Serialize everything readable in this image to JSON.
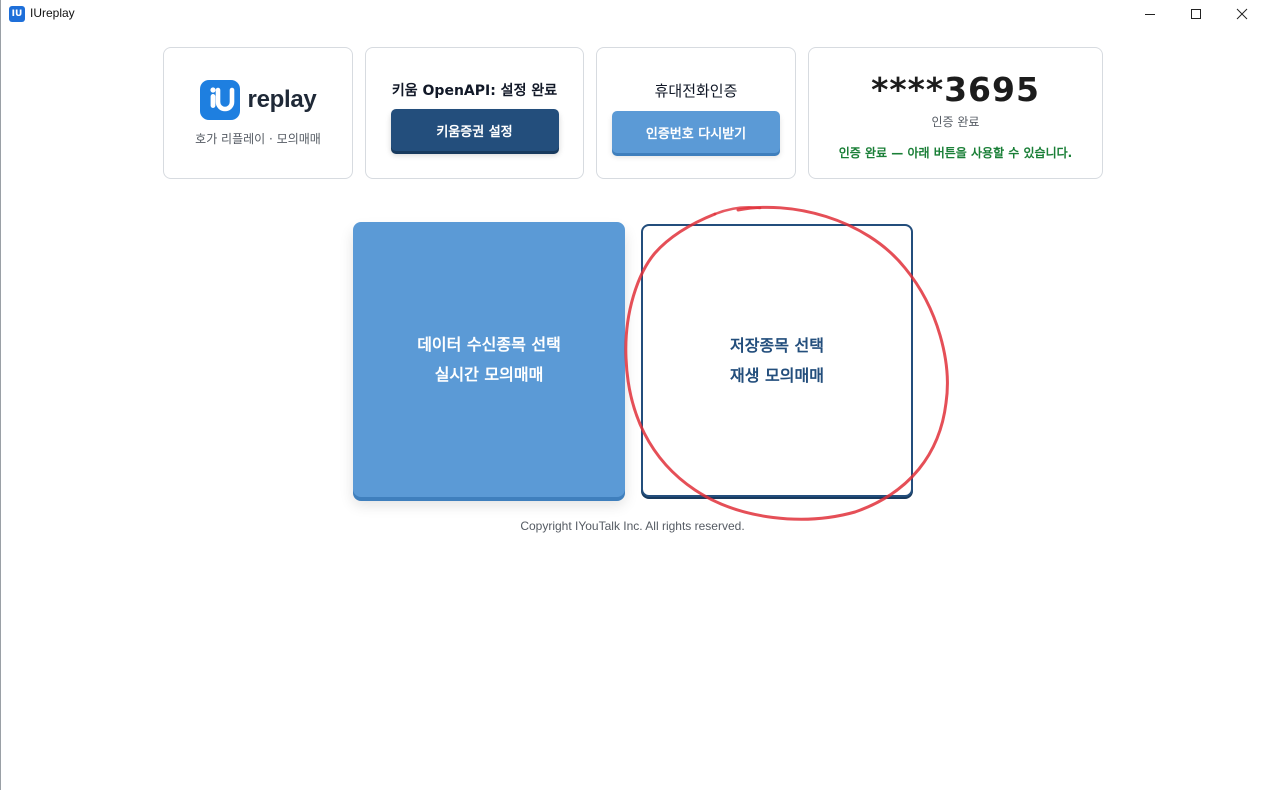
{
  "window": {
    "title": "IUreplay",
    "app_icon_text": "IU"
  },
  "logo_card": {
    "brand": "replay",
    "subtitle": "호가 리플레이 · 모의매매",
    "accent": "#1e7fe0"
  },
  "kiwoom_card": {
    "title": "키움 OpenAPI: 설정 완료",
    "button_label": "키움증권 설정"
  },
  "phone_card": {
    "title": "휴대전화인증",
    "button_label": "인증번호 다시받기"
  },
  "auth_card": {
    "masked_number": "****3695",
    "status": "인증 완료",
    "message": "인증 완료 — 아래 버튼을 사용할 수 있습니다.",
    "message_color": "#1a7f37"
  },
  "main": {
    "live_button": {
      "line1": "데이터 수신종목 선택",
      "line2": "실시간 모의매매"
    },
    "replay_button": {
      "line1": "저장종목 선택",
      "line2": "재생 모의매매"
    }
  },
  "footer": {
    "copyright": "Copyright IYouTalk Inc. All rights reserved."
  },
  "colors": {
    "dark_blue": "#234e7c",
    "light_blue": "#5b9ad6",
    "annotation_red": "#e0303a"
  }
}
